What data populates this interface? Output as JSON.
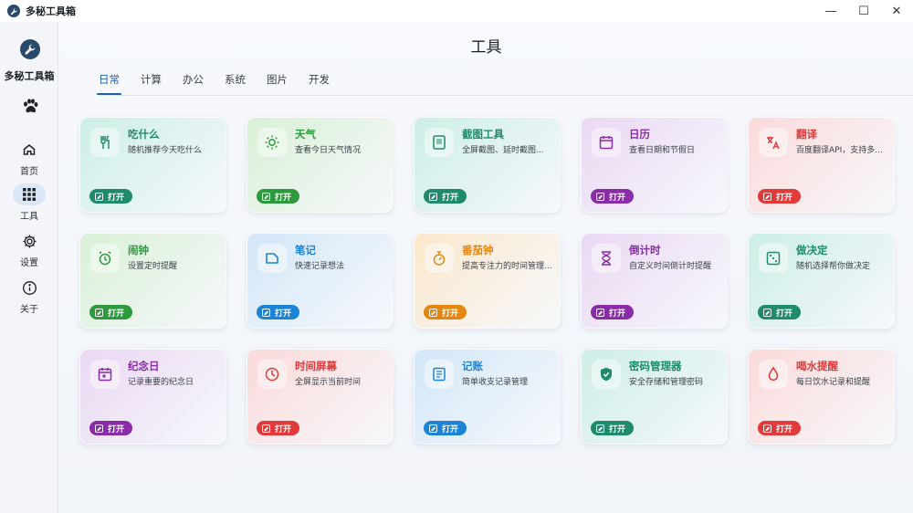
{
  "window": {
    "title": "多秘工具箱",
    "controls": [
      "—",
      "☐",
      "✕"
    ]
  },
  "sidebar": {
    "brand": "多秘工具箱",
    "items": [
      {
        "label": "首页",
        "icon": "home-icon"
      },
      {
        "label": "工具",
        "icon": "apps-grid-icon",
        "active": true
      },
      {
        "label": "设置",
        "icon": "gear-icon"
      },
      {
        "label": "关于",
        "icon": "info-icon"
      }
    ]
  },
  "main": {
    "title": "工具",
    "tabs": [
      "日常",
      "计算",
      "办公",
      "系统",
      "图片",
      "开发"
    ],
    "active_tab": "日常"
  },
  "cards": [
    {
      "title": "吃什么",
      "desc": "随机推荐今天吃什么",
      "button": "打开",
      "icon": "utensils-icon",
      "accent": "#1f8a6c",
      "bg": "#cdeee6"
    },
    {
      "title": "天气",
      "desc": "查看今日天气情况",
      "button": "打开",
      "icon": "sun-icon",
      "accent": "#2e9a3e",
      "bg": "#d9f0d6"
    },
    {
      "title": "截图工具",
      "desc": "全屏截图、延时截图...",
      "button": "打开",
      "icon": "screenshot-icon",
      "accent": "#1f8a6c",
      "bg": "#cdeee6"
    },
    {
      "title": "日历",
      "desc": "查看日期和节假日",
      "button": "打开",
      "icon": "calendar-icon",
      "accent": "#8a2ba8",
      "bg": "#ead8f3"
    },
    {
      "title": "翻译",
      "desc": "百度翻译API，支持多...",
      "button": "打开",
      "icon": "translate-icon",
      "accent": "#e03a3a",
      "bg": "#fbdada"
    },
    {
      "title": "闹钟",
      "desc": "设置定时提醒",
      "button": "打开",
      "icon": "alarm-icon",
      "accent": "#2e9a3e",
      "bg": "#d9f0d6"
    },
    {
      "title": "笔记",
      "desc": "快速记录想法",
      "button": "打开",
      "icon": "note-icon",
      "accent": "#1d83d4",
      "bg": "#d3e7f8"
    },
    {
      "title": "番茄钟",
      "desc": "提高专注力的时间管理...",
      "button": "打开",
      "icon": "timer-icon",
      "accent": "#e6870f",
      "bg": "#fbe8cc"
    },
    {
      "title": "倒计时",
      "desc": "自定义时间倒计时提醒",
      "button": "打开",
      "icon": "hourglass-icon",
      "accent": "#8a2ba8",
      "bg": "#ead8f3"
    },
    {
      "title": "做决定",
      "desc": "随机选择帮你做决定",
      "button": "打开",
      "icon": "dice-icon",
      "accent": "#1f8a6c",
      "bg": "#cdeee6"
    },
    {
      "title": "纪念日",
      "desc": "记录重要的纪念日",
      "button": "打开",
      "icon": "event-icon",
      "accent": "#8a2ba8",
      "bg": "#ead8f3"
    },
    {
      "title": "时间屏幕",
      "desc": "全屏显示当前时间",
      "button": "打开",
      "icon": "clock-icon",
      "accent": "#e03a3a",
      "bg": "#fbdada"
    },
    {
      "title": "记账",
      "desc": "简单收支记录管理",
      "button": "打开",
      "icon": "ledger-icon",
      "accent": "#1d83d4",
      "bg": "#d3e7f8"
    },
    {
      "title": "密码管理器",
      "desc": "安全存储和管理密码",
      "button": "打开",
      "icon": "shield-icon",
      "accent": "#1f8a6c",
      "bg": "#cdeee6"
    },
    {
      "title": "喝水提醒",
      "desc": "每日饮水记录和提醒",
      "button": "打开",
      "icon": "water-drop-icon",
      "accent": "#e03a3a",
      "bg": "#fbdada"
    }
  ]
}
